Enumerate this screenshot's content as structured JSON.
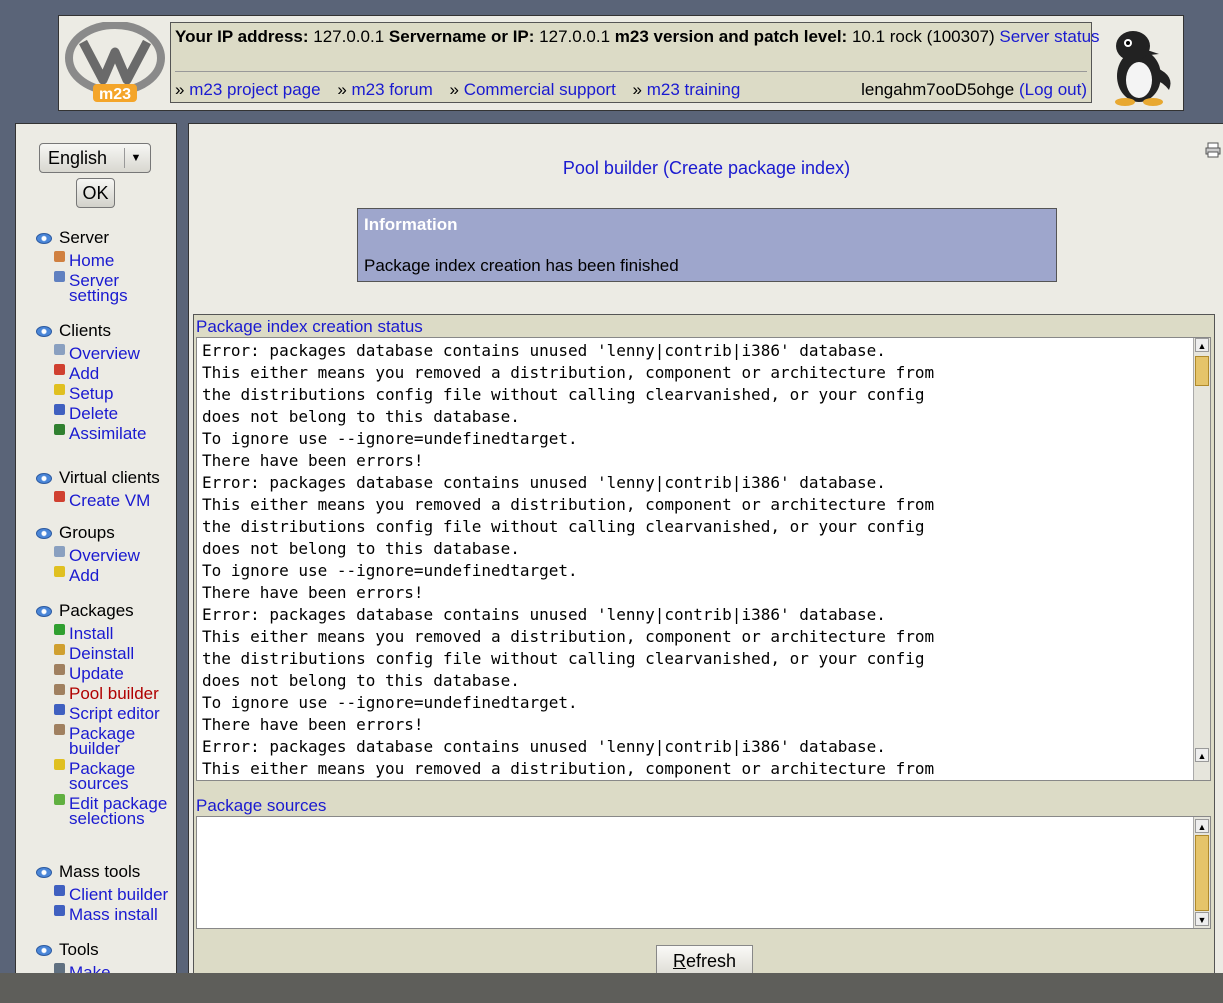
{
  "header": {
    "ip_label": "Your IP address:",
    "ip_value": "127.0.0.1",
    "server_label": "Servername or IP:",
    "server_value": "127.0.0.1",
    "version_label": "m23 version and patch level:",
    "version_value": "10.1 rock (100307)",
    "server_status": "Server status",
    "links": [
      "m23 project page",
      "m23 forum",
      "Commercial support",
      "m23 training"
    ],
    "link_prefix": "»",
    "username": "lengahm7ooD5ohge",
    "logout": "(Log out)"
  },
  "sidebar": {
    "language": "English",
    "ok_label": "OK",
    "groups": [
      {
        "label": "Server",
        "items": [
          {
            "label": "Home",
            "icon": "home-icon"
          },
          {
            "label": "Server settings",
            "icon": "settings-icon"
          }
        ]
      },
      {
        "label": "Clients",
        "items": [
          {
            "label": "Overview",
            "icon": "magnifier-icon"
          },
          {
            "label": "Add",
            "icon": "add-client-icon"
          },
          {
            "label": "Setup",
            "icon": "setup-icon"
          },
          {
            "label": "Delete",
            "icon": "delete-icon"
          },
          {
            "label": "Assimilate",
            "icon": "assimilate-icon"
          }
        ]
      },
      {
        "label": "Virtual clients",
        "items": [
          {
            "label": "Create VM",
            "icon": "create-vm-icon"
          }
        ]
      },
      {
        "label": "Groups",
        "items": [
          {
            "label": "Overview",
            "icon": "magnifier-icon"
          },
          {
            "label": "Add",
            "icon": "star-icon"
          }
        ]
      },
      {
        "label": "Packages",
        "items": [
          {
            "label": "Install",
            "icon": "install-icon"
          },
          {
            "label": "Deinstall",
            "icon": "deinstall-icon"
          },
          {
            "label": "Update",
            "icon": "update-icon"
          },
          {
            "label": "Pool builder",
            "icon": "pool-icon",
            "active": true
          },
          {
            "label": "Script editor",
            "icon": "script-icon"
          },
          {
            "label": "Package builder",
            "icon": "package-icon"
          },
          {
            "label": "Package sources",
            "icon": "sources-icon"
          },
          {
            "label": "Edit package selections",
            "icon": "selections-icon"
          }
        ]
      },
      {
        "label": "Mass tools",
        "items": [
          {
            "label": "Client builder",
            "icon": "client-builder-icon"
          },
          {
            "label": "Mass install",
            "icon": "mass-install-icon"
          }
        ]
      },
      {
        "label": "Tools",
        "items": [
          {
            "label": "Make",
            "icon": "make-icon"
          }
        ]
      }
    ]
  },
  "main": {
    "title": "Pool builder (Create package index)",
    "info_title": "Information",
    "info_message": "Package index creation has been finished",
    "status_title": "Package index creation status",
    "log_lines": [
      "Error: packages database contains unused 'lenny|contrib|i386' database.",
      "This either means you removed a distribution, component or architecture from",
      "the distributions config file without calling clearvanished, or your config",
      "does not belong to this database.",
      "To ignore use --ignore=undefinedtarget.",
      "There have been errors!",
      "Error: packages database contains unused 'lenny|contrib|i386' database.",
      "This either means you removed a distribution, component or architecture from",
      "the distributions config file without calling clearvanished, or your config",
      "does not belong to this database.",
      "To ignore use --ignore=undefinedtarget.",
      "There have been errors!",
      "Error: packages database contains unused 'lenny|contrib|i386' database.",
      "This either means you removed a distribution, component or architecture from",
      "the distributions config file without calling clearvanished, or your config",
      "does not belong to this database.",
      "To ignore use --ignore=undefinedtarget.",
      "There have been errors!",
      "Error: packages database contains unused 'lenny|contrib|i386' database.",
      "This either means you removed a distribution, component or architecture from"
    ],
    "sources_title": "Package sources",
    "sources_value": "",
    "refresh_label_accesskey": "R",
    "refresh_label_rest": "efresh"
  }
}
